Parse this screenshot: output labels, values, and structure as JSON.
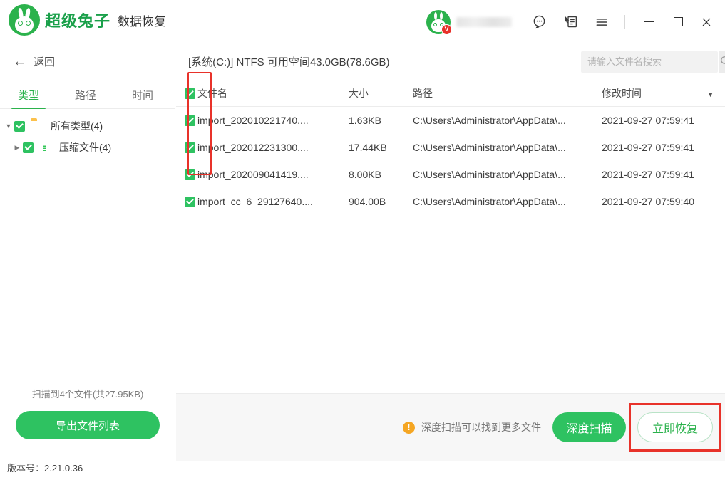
{
  "titlebar": {
    "brand_name": "超级兔子",
    "brand_sub": "数据恢复",
    "logo_icon": "rabbit-logo-icon",
    "avatar_icon": "rabbit-avatar-icon",
    "vip_badge": "V",
    "username": "",
    "icons": [
      {
        "name": "customer-service-icon",
        "glyph": "chat-bubble"
      },
      {
        "name": "feedback-icon",
        "glyph": "feedback-document"
      },
      {
        "name": "menu-icon",
        "glyph": "hamburger"
      }
    ],
    "window_controls": {
      "minimize": "—",
      "maximize": "□",
      "close": "✕"
    }
  },
  "sidebar": {
    "back_label": "返回",
    "back_icon": "arrow-left-icon",
    "tabs": [
      {
        "label": "类型",
        "active": true
      },
      {
        "label": "路径",
        "active": false
      },
      {
        "label": "时间",
        "active": false
      }
    ],
    "tree": [
      {
        "label": "所有类型(4)",
        "icon": "folder-icon",
        "checked": true,
        "expanded": true,
        "level": 1
      },
      {
        "label": "压缩文件(4)",
        "icon": "archive-file-icon",
        "checked": true,
        "expanded": false,
        "level": 2
      }
    ],
    "scan_status": "扫描到4个文件(共27.95KB)",
    "export_label": "导出文件列表"
  },
  "main": {
    "drive_label": "[系统(C:)] NTFS 可用空间43.0GB(78.6GB)",
    "search": {
      "placeholder": "请输入文件名搜索",
      "value": "",
      "icon": "search-icon"
    },
    "table": {
      "headers": {
        "name": "文件名",
        "size": "大小",
        "path": "路径",
        "time": "修改时间"
      },
      "sort_caret": "▼",
      "select_all_checked": true,
      "rows": [
        {
          "checked": true,
          "name": "import_202010221740....",
          "size": "1.63KB",
          "path": "C:\\Users\\Administrator\\AppData\\...",
          "time": "2021-09-27 07:59:41"
        },
        {
          "checked": true,
          "name": "import_202012231300....",
          "size": "17.44KB",
          "path": "C:\\Users\\Administrator\\AppData\\...",
          "time": "2021-09-27 07:59:41"
        },
        {
          "checked": true,
          "name": "import_202009041419....",
          "size": "8.00KB",
          "path": "C:\\Users\\Administrator\\AppData\\...",
          "time": "2021-09-27 07:59:41"
        },
        {
          "checked": true,
          "name": "import_cc_6_29127640....",
          "size": "904.00B",
          "path": "C:\\Users\\Administrator\\AppData\\...",
          "time": "2021-09-27 07:59:40"
        }
      ]
    }
  },
  "bottombar": {
    "warn_icon": "warning-icon",
    "warn_glyph": "!",
    "hint": "深度扫描可以找到更多文件",
    "deep_scan_label": "深度扫描",
    "recover_label": "立即恢复"
  },
  "statusbar": {
    "version": "版本号：2.21.0.36"
  },
  "colors": {
    "brand_green": "#2bb24c",
    "button_green": "#2ec261",
    "annotation_red": "#e8322a",
    "warning_orange": "#f5a623",
    "folder_yellow": "#fcc14c"
  }
}
